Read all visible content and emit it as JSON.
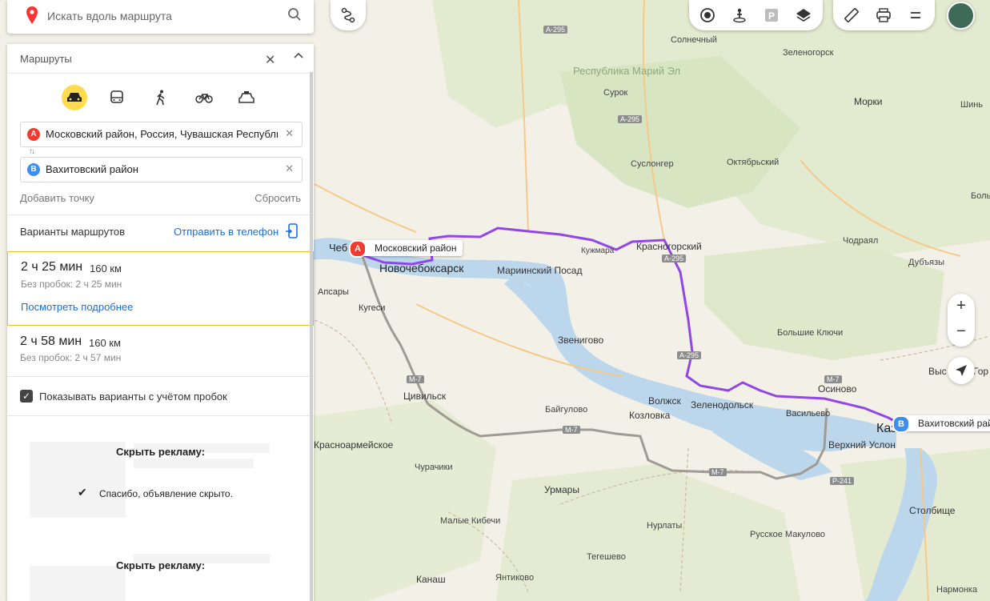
{
  "search": {
    "placeholder": "Искать вдоль маршрута"
  },
  "routes_panel": {
    "title": "Маршруты",
    "point_a": {
      "badge": "A",
      "value": "Московский район, Россия, Чувашская Республика"
    },
    "point_b": {
      "badge": "B",
      "value": "Вахитовский район"
    },
    "swap_label": "↑↓",
    "add_point": "Добавить точку",
    "reset": "Сбросить",
    "variants_label": "Варианты маршрутов",
    "send_to_phone": "Отправить в телефон",
    "options": [
      {
        "time": "2 ч 25 мин",
        "distance": "160 км",
        "no_traffic": "Без пробок: 2 ч 25 мин",
        "details": "Посмотреть подробнее"
      },
      {
        "time": "2 ч 58 мин",
        "distance": "160 км",
        "no_traffic": "Без пробок: 2 ч 57 мин"
      }
    ],
    "traffic_checkbox": "Показывать варианты с учётом пробок",
    "ads": [
      {
        "hide": "Скрыть рекламу:",
        "thanks": "Спасибо, объявление скрыто."
      },
      {
        "hide": "Скрыть рекламу:"
      }
    ]
  },
  "map": {
    "point_a_label": "Московский район",
    "point_b_label": "Вахитовский район",
    "colors": {
      "route_main": "#9146e8",
      "route_alt": "#a09a94",
      "point_a": "#f33a2e",
      "point_b": "#3e8ef2",
      "water": "#bcd7ec",
      "forest": "#dfe8c8"
    },
    "places": [
      {
        "name": "Солнечный"
      },
      {
        "name": "Зеленогорск"
      },
      {
        "name": "Республика Марий Эл"
      },
      {
        "name": "Сурок"
      },
      {
        "name": "Морки"
      },
      {
        "name": "Шинь"
      },
      {
        "name": "Суслонгер"
      },
      {
        "name": "Октябрьский"
      },
      {
        "name": "Боль"
      },
      {
        "name": "Красногорский"
      },
      {
        "name": "Кужмара"
      },
      {
        "name": "Чодраял"
      },
      {
        "name": "Дубъязы"
      },
      {
        "name": "Чеб"
      },
      {
        "name": "Новочебоксарск"
      },
      {
        "name": "Мариинский Посад"
      },
      {
        "name": "Апсары"
      },
      {
        "name": "Кугеси"
      },
      {
        "name": "Звенигово"
      },
      {
        "name": "Большие Ключи"
      },
      {
        "name": "Выс"
      },
      {
        "name": "Гор"
      },
      {
        "name": "Цивильск"
      },
      {
        "name": "Волжск"
      },
      {
        "name": "Зеленодольск"
      },
      {
        "name": "Осиново"
      },
      {
        "name": "Васильево"
      },
      {
        "name": "Байгулово"
      },
      {
        "name": "Козловка"
      },
      {
        "name": "Красноармейское"
      },
      {
        "name": "Верхний Услон"
      },
      {
        "name": "Каз"
      },
      {
        "name": "Чурачики"
      },
      {
        "name": "Урмары"
      },
      {
        "name": "Столбище"
      },
      {
        "name": "Малые Кибечи"
      },
      {
        "name": "Нурлаты"
      },
      {
        "name": "Русское Макулово"
      },
      {
        "name": "Тегешево"
      },
      {
        "name": "Канаш"
      },
      {
        "name": "Янтиково"
      },
      {
        "name": "Нармонка"
      }
    ],
    "roads": [
      {
        "name": "А-295"
      },
      {
        "name": "А-295"
      },
      {
        "name": "А-295"
      },
      {
        "name": "А-295"
      },
      {
        "name": "М-7"
      },
      {
        "name": "М-7"
      },
      {
        "name": "М-7"
      },
      {
        "name": "М-7"
      },
      {
        "name": "Р-241"
      }
    ],
    "zoom_in": "+",
    "zoom_out": "−"
  }
}
